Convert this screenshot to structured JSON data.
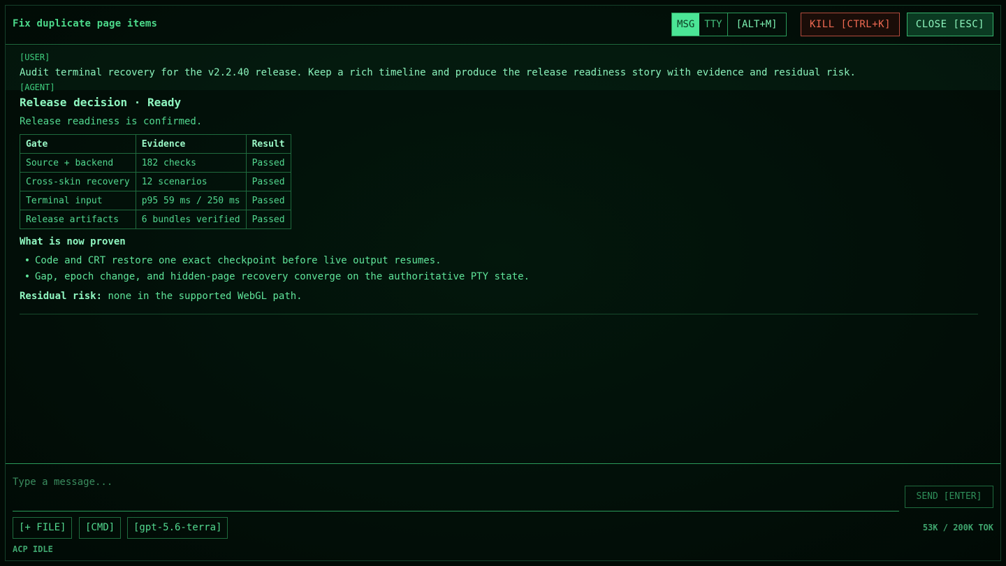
{
  "header": {
    "title": "Fix duplicate page items",
    "modes": [
      "MSG",
      "TTY"
    ],
    "active_mode": "MSG",
    "mode_shortcut": "[ALT+M]",
    "kill_label": "KILL [CTRL+K]",
    "close_label": "CLOSE [ESC]"
  },
  "conversation": {
    "user_role": "[USER]",
    "user_message": "Audit terminal recovery for the v2.2.40 release. Keep a rich timeline and produce the release readiness story with evidence and residual risk.",
    "agent_role": "[AGENT]",
    "decision_title": "Release decision · Ready",
    "status": "Release readiness is confirmed.",
    "table": {
      "headers": [
        "Gate",
        "Evidence",
        "Result"
      ],
      "rows": [
        [
          "Source + backend",
          "182 checks",
          "Passed"
        ],
        [
          "Cross-skin recovery",
          "12 scenarios",
          "Passed"
        ],
        [
          "Terminal input",
          "p95 59 ms / 250 ms",
          "Passed"
        ],
        [
          "Release artifacts",
          "6 bundles verified",
          "Passed"
        ]
      ]
    },
    "proven_heading": "What is now proven",
    "proven_items": [
      "Code and CRT restore one exact checkpoint before live output resumes.",
      "Gap, epoch change, and hidden-page recovery converge on the authoritative PTY state."
    ],
    "residual_label": "Residual risk:",
    "residual_text": "none in the supported WebGL path."
  },
  "composer": {
    "placeholder": "Type a message...",
    "value": "",
    "send_label": "SEND [ENTER]",
    "chips": [
      "[+ FILE]",
      "[CMD]",
      "[gpt-5.6-terra]"
    ],
    "tokens": "53K / 200K TOK",
    "status": "ACP IDLE"
  },
  "colors": {
    "accent": "#4be596",
    "danger": "#f06a52",
    "background": "#010a05"
  }
}
